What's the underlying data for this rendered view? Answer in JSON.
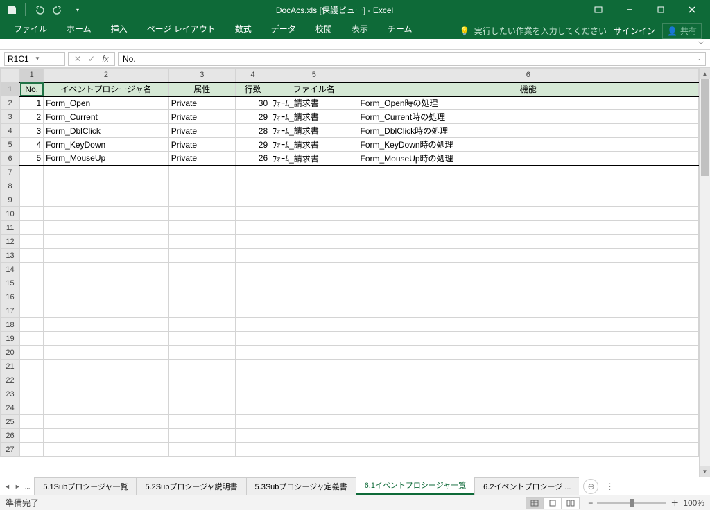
{
  "title": "DocAcs.xls  [保護ビュー] - Excel",
  "qat": {
    "save": "保存",
    "undo": "元に戻す",
    "redo": "やり直し"
  },
  "ribbon": {
    "tabs": [
      "ファイル",
      "ホーム",
      "挿入",
      "ページ レイアウト",
      "数式",
      "データ",
      "校閲",
      "表示",
      "チーム"
    ],
    "tell_me": "実行したい作業を入力してください",
    "signin": "サインイン",
    "share": "共有"
  },
  "name_box": "R1C1",
  "formula": "No.",
  "col_headers": [
    "1",
    "2",
    "3",
    "4",
    "5",
    "6"
  ],
  "row_headers_count": 27,
  "table": {
    "headers": [
      "No.",
      "イベントプロシージャ名",
      "属性",
      "行数",
      "ファイル名",
      "機能"
    ],
    "rows": [
      {
        "no": 1,
        "name": "Form_Open",
        "attr": "Private",
        "lines": 30,
        "file": "ﾌｫｰﾑ_請求書",
        "func": "Form_Open時の処理"
      },
      {
        "no": 2,
        "name": "Form_Current",
        "attr": "Private",
        "lines": 29,
        "file": "ﾌｫｰﾑ_請求書",
        "func": "Form_Current時の処理"
      },
      {
        "no": 3,
        "name": "Form_DblClick",
        "attr": "Private",
        "lines": 28,
        "file": "ﾌｫｰﾑ_請求書",
        "func": "Form_DblClick時の処理"
      },
      {
        "no": 4,
        "name": "Form_KeyDown",
        "attr": "Private",
        "lines": 29,
        "file": "ﾌｫｰﾑ_請求書",
        "func": "Form_KeyDown時の処理"
      },
      {
        "no": 5,
        "name": "Form_MouseUp",
        "attr": "Private",
        "lines": 26,
        "file": "ﾌｫｰﾑ_請求書",
        "func": "Form_MouseUp時の処理"
      }
    ]
  },
  "sheets": {
    "ellipsis": "...",
    "tabs": [
      "5.1Subプロシージャ一覧",
      "5.2Subプロシージャ説明書",
      "5.3Subプロシージャ定義書",
      "6.1イベントプロシージャ一覧",
      "6.2イベントプロシージ ..."
    ],
    "active_index": 3
  },
  "status": {
    "ready": "準備完了",
    "zoom": "100%"
  },
  "zoom_controls": {
    "minus": "−",
    "plus": "＋"
  }
}
